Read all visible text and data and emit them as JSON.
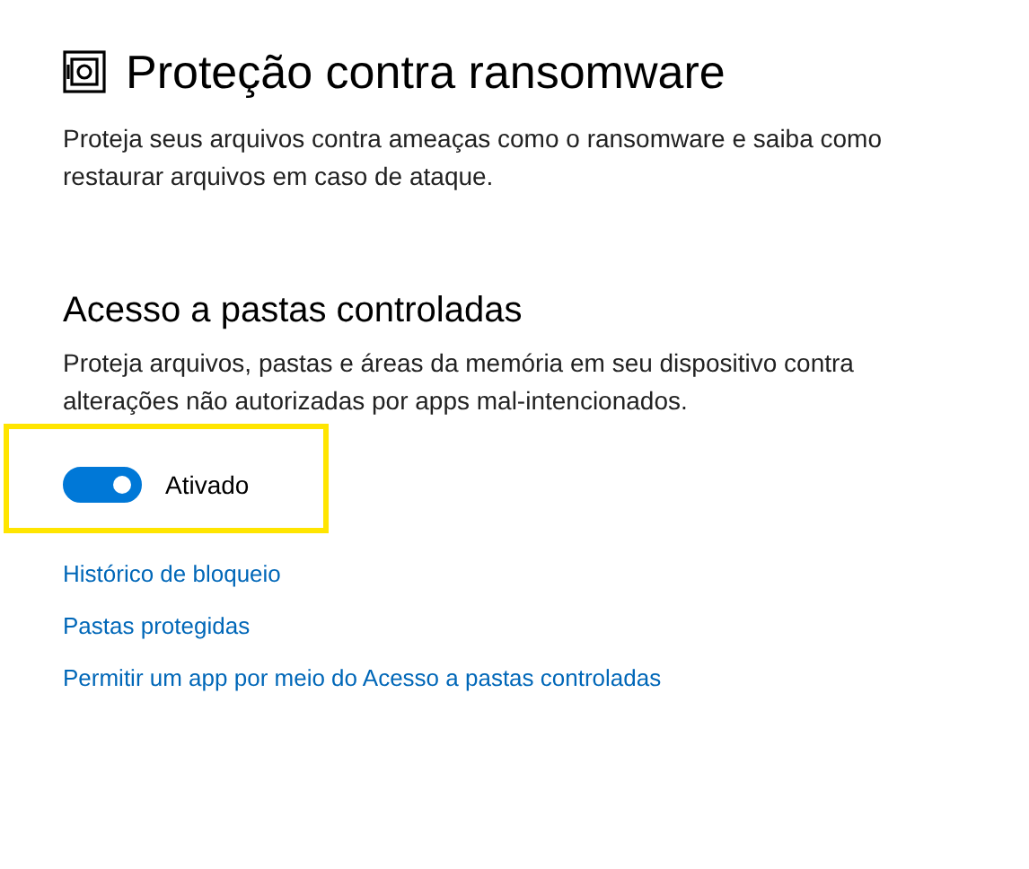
{
  "title": "Proteção contra ransomware",
  "description": "Proteja seus arquivos contra ameaças como o ransomware e saiba como restaurar arquivos em caso de ataque.",
  "section": {
    "heading": "Acesso a pastas controladas",
    "description": "Proteja arquivos, pastas e áreas da memória em seu dispositivo contra alterações não autorizadas por apps mal-intencionados."
  },
  "toggle": {
    "on": true,
    "label": "Ativado",
    "highlighted": true
  },
  "links": [
    "Histórico de bloqueio",
    "Pastas protegidas",
    "Permitir um app por meio do Acesso a pastas controladas"
  ]
}
